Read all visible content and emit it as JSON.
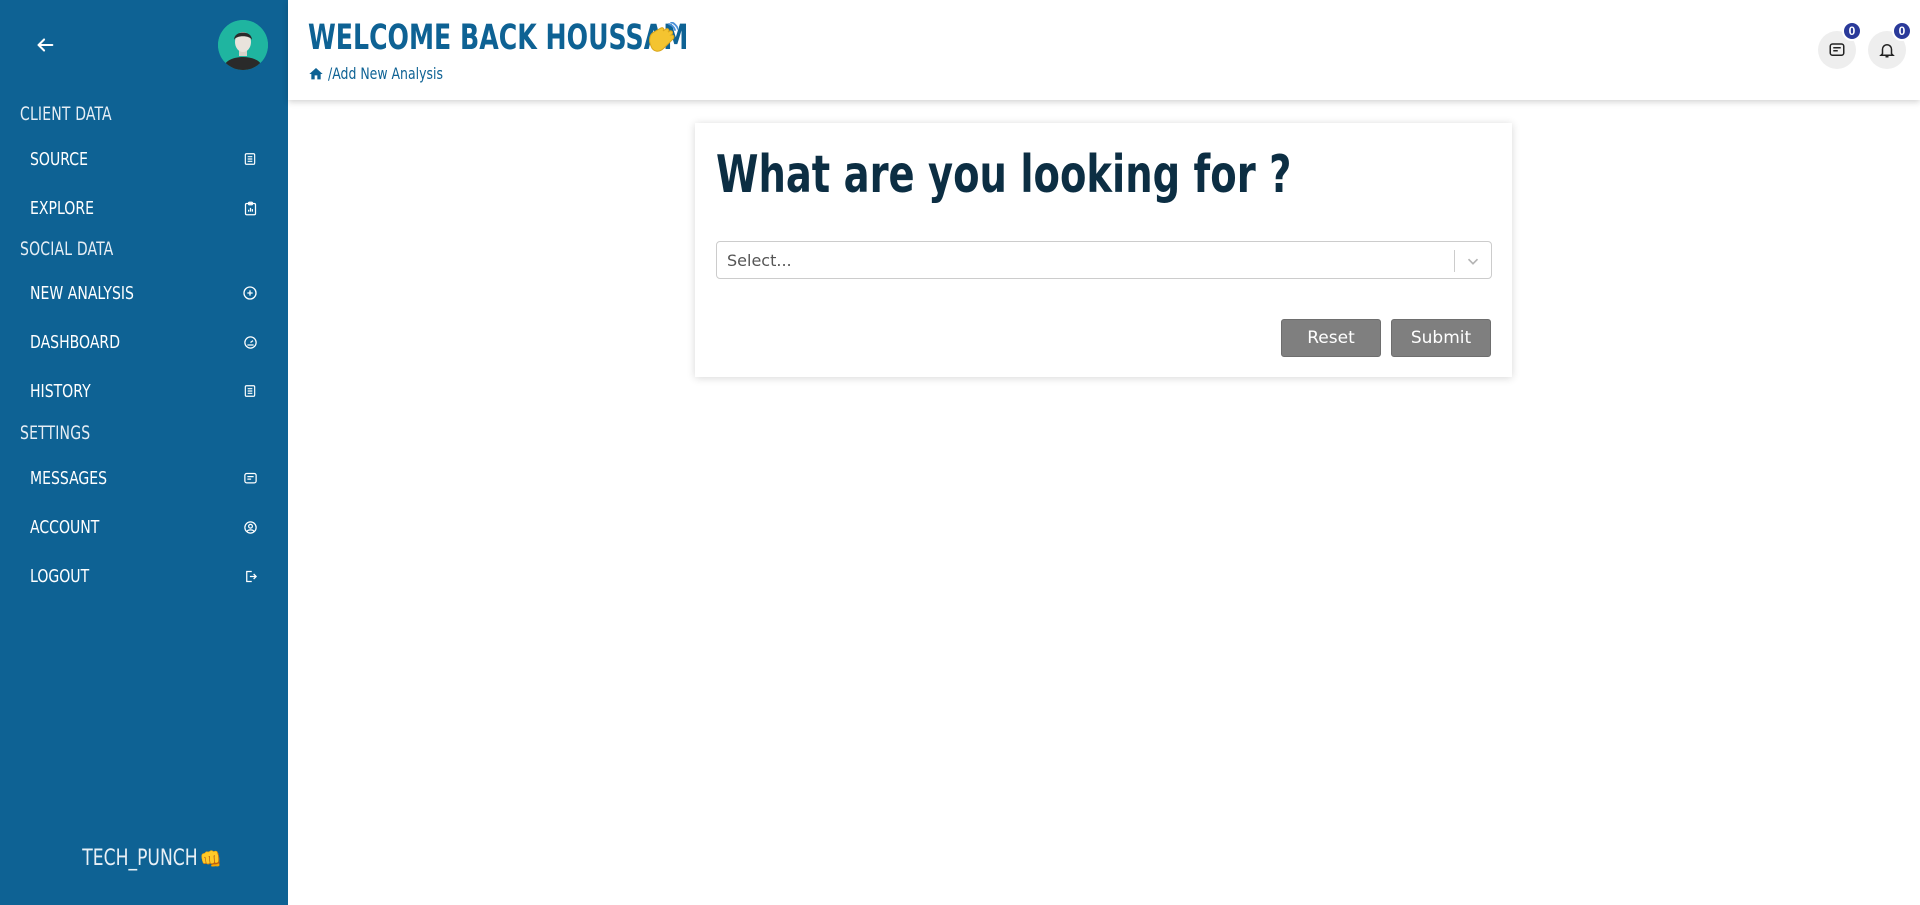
{
  "sidebar": {
    "sections": [
      {
        "title": "CLIENT DATA",
        "items": [
          {
            "label": "SOURCE",
            "icon": "list-icon"
          },
          {
            "label": "EXPLORE",
            "icon": "clipboard-chart-icon"
          }
        ]
      },
      {
        "title": "SOCIAL DATA",
        "items": [
          {
            "label": "NEW ANALYSIS",
            "icon": "plus-circle-icon"
          },
          {
            "label": "DASHBOARD",
            "icon": "gauge-icon"
          },
          {
            "label": "HISTORY",
            "icon": "list-icon"
          }
        ]
      },
      {
        "title": "SETTINGS",
        "items": [
          {
            "label": "MESSAGES",
            "icon": "message-icon"
          },
          {
            "label": "ACCOUNT",
            "icon": "user-circle-icon"
          },
          {
            "label": "LOGOUT",
            "icon": "logout-icon"
          }
        ]
      }
    ],
    "brand": "TECH_PUNCH",
    "brand_emoji": "👊"
  },
  "header": {
    "welcome": "WELCOME BACK HOUSSAM",
    "breadcrumb": "/Add New Analysis",
    "messages_count": "0",
    "notifications_count": "0"
  },
  "main": {
    "title": "What are you looking for ?",
    "select_placeholder": "Select...",
    "reset_label": "Reset",
    "submit_label": "Submit"
  },
  "colors": {
    "sidebar_bg": "#0e6294",
    "title_text": "#0c2e43",
    "button_bg": "#7f7f7f",
    "badge_bg": "#2a3a9a"
  }
}
